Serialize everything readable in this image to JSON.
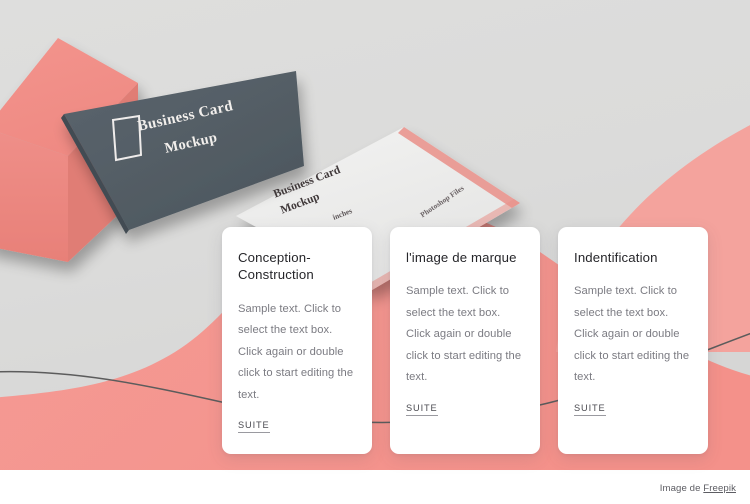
{
  "hero": {
    "mockup_card_dark": {
      "line1": "Business Card",
      "line2": "Mockup",
      "icon": "square-outline-icon"
    },
    "mockup_card_white": {
      "line1": "Business Card",
      "line2": "Mockup",
      "unit_label": "inches",
      "files_label": "Photoshop Files"
    },
    "colors": {
      "background_gray": "#dcdcdc",
      "salmon": "#f2918c",
      "salmon_light": "#f7a6a0",
      "card_dark": "#545e66",
      "card_white": "#ececec",
      "page_white": "#ffffff",
      "line_gray": "#5c5c5c"
    }
  },
  "cards": [
    {
      "title": "Conception-Construction",
      "body": "Sample text. Click to select the text box. Click again or double click to start editing the text.",
      "link": "SUITE"
    },
    {
      "title": "l'image de marque",
      "body": "Sample text. Click to select the text box. Click again or double click to start editing the text.",
      "link": "SUITE"
    },
    {
      "title": "Indentification",
      "body": "Sample text. Click to select the text box. Click again or double click to start editing the text.",
      "link": "SUITE"
    }
  ],
  "credit": {
    "prefix": "Image de ",
    "link": "Freepik"
  }
}
